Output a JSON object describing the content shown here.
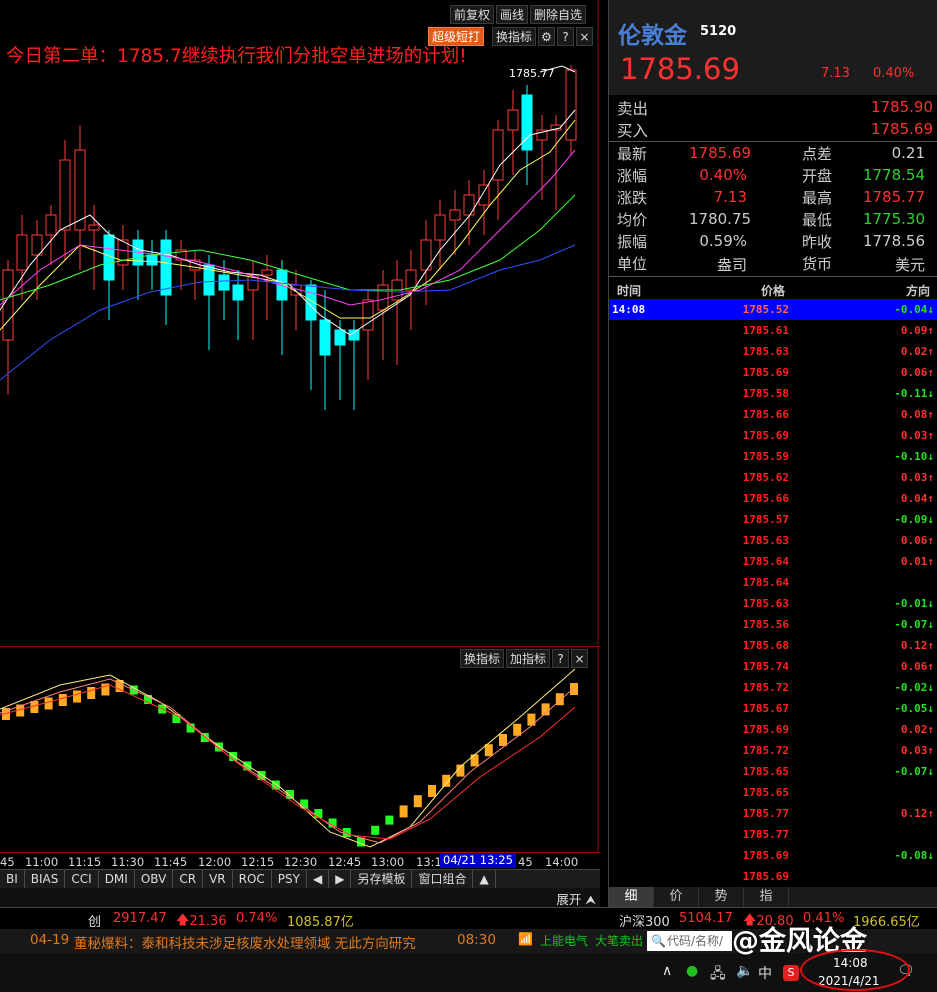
{
  "toolbar": {
    "adjust": "前复权",
    "draw": "画线",
    "delete_self_select": "删除自选",
    "super_short": "超级短打",
    "change_indicator": "换指标",
    "settings_icon": "gear-icon",
    "help": "?",
    "close": "×"
  },
  "chart": {
    "title": "今日第二单：1785.7继续执行我们分批空单进场的计划!",
    "high_tag": "1785.77"
  },
  "indicator_panel": {
    "change_indicator": "换指标",
    "add_indicator": "加指标",
    "help": "?",
    "close": "×"
  },
  "time_axis": {
    "labels": [
      "45",
      "11:00",
      "11:15",
      "11:30",
      "11:45",
      "12:00",
      "12:15",
      "12:30",
      "12:45",
      "13:00",
      "13:1",
      "45",
      "14:00"
    ],
    "cursor": "04/21 13:25"
  },
  "indicator_tabs": [
    "BI",
    "BIAS",
    "CCI",
    "DMI",
    "OBV",
    "CR",
    "VR",
    "ROC",
    "PSY",
    "◀",
    "▶",
    "另存模板",
    "窗口组合",
    "▲"
  ],
  "expand_label": "展开",
  "quote": {
    "name": "伦敦金",
    "code": "5120",
    "price": "1785.69",
    "change": "7.13",
    "pct": "0.40%",
    "sell_label": "卖出",
    "sell": "1785.90",
    "buy_label": "买入",
    "buy": "1785.69",
    "stats": [
      {
        "l1": "最新",
        "v1": "1785.69",
        "c1": "#ff3030",
        "l2": "点差",
        "v2": "0.21",
        "c2": "#cccccc"
      },
      {
        "l1": "涨幅",
        "v1": "0.40%",
        "c1": "#ff3030",
        "l2": "开盘",
        "v2": "1778.54",
        "c2": "#30d030"
      },
      {
        "l1": "涨跌",
        "v1": "7.13",
        "c1": "#ff3030",
        "l2": "最高",
        "v2": "1785.77",
        "c2": "#ff3030"
      },
      {
        "l1": "均价",
        "v1": "1780.75",
        "c1": "#cccccc",
        "l2": "最低",
        "v2": "1775.30",
        "c2": "#30d030"
      },
      {
        "l1": "振幅",
        "v1": "0.59%",
        "c1": "#cccccc",
        "l2": "昨收",
        "v2": "1778.56",
        "c2": "#cccccc"
      },
      {
        "l1": "单位",
        "v1": "盎司",
        "c1": "#cccccc",
        "l2": "货币",
        "v2": "美元",
        "c2": "#cccccc"
      }
    ],
    "tick_header": {
      "time": "时间",
      "price": "价格",
      "dir": "方向"
    },
    "ticks": [
      {
        "time": "14:08",
        "price": "1785.52",
        "dir": "-0.04↓",
        "up": false
      },
      {
        "time": "",
        "price": "1785.61",
        "dir": "0.09↑",
        "up": true
      },
      {
        "time": "",
        "price": "1785.63",
        "dir": "0.02↑",
        "up": true
      },
      {
        "time": "",
        "price": "1785.69",
        "dir": "0.06↑",
        "up": true
      },
      {
        "time": "",
        "price": "1785.58",
        "dir": "-0.11↓",
        "up": false
      },
      {
        "time": "",
        "price": "1785.66",
        "dir": "0.08↑",
        "up": true
      },
      {
        "time": "",
        "price": "1785.69",
        "dir": "0.03↑",
        "up": true
      },
      {
        "time": "",
        "price": "1785.59",
        "dir": "-0.10↓",
        "up": false
      },
      {
        "time": "",
        "price": "1785.62",
        "dir": "0.03↑",
        "up": true
      },
      {
        "time": "",
        "price": "1785.66",
        "dir": "0.04↑",
        "up": true
      },
      {
        "time": "",
        "price": "1785.57",
        "dir": "-0.09↓",
        "up": false
      },
      {
        "time": "",
        "price": "1785.63",
        "dir": "0.06↑",
        "up": true
      },
      {
        "time": "",
        "price": "1785.64",
        "dir": "0.01↑",
        "up": true
      },
      {
        "time": "",
        "price": "1785.64",
        "dir": "",
        "up": true
      },
      {
        "time": "",
        "price": "1785.63",
        "dir": "-0.01↓",
        "up": false
      },
      {
        "time": "",
        "price": "1785.56",
        "dir": "-0.07↓",
        "up": false
      },
      {
        "time": "",
        "price": "1785.68",
        "dir": "0.12↑",
        "up": true
      },
      {
        "time": "",
        "price": "1785.74",
        "dir": "0.06↑",
        "up": true
      },
      {
        "time": "",
        "price": "1785.72",
        "dir": "-0.02↓",
        "up": false
      },
      {
        "time": "",
        "price": "1785.67",
        "dir": "-0.05↓",
        "up": false
      },
      {
        "time": "",
        "price": "1785.69",
        "dir": "0.02↑",
        "up": true
      },
      {
        "time": "",
        "price": "1785.72",
        "dir": "0.03↑",
        "up": true
      },
      {
        "time": "",
        "price": "1785.65",
        "dir": "-0.07↓",
        "up": false
      },
      {
        "time": "",
        "price": "1785.65",
        "dir": "",
        "up": true
      },
      {
        "time": "",
        "price": "1785.77",
        "dir": "0.12↑",
        "up": true
      },
      {
        "time": "",
        "price": "1785.77",
        "dir": "",
        "up": true
      },
      {
        "time": "",
        "price": "1785.69",
        "dir": "-0.08↓",
        "up": false
      },
      {
        "time": "",
        "price": "1785.69",
        "dir": "",
        "up": true
      }
    ],
    "tabs": [
      "细",
      "价",
      "势",
      "指"
    ]
  },
  "ticker": {
    "chuang_label": "创",
    "chuang_val": "2917.47",
    "chuang_chg": "21.36",
    "chuang_pct": "0.74%",
    "chuang_amt": "1085.87亿",
    "hs_label": "沪深300",
    "hs_val": "5104.17",
    "hs_chg": "20.80",
    "hs_pct": "0.41%",
    "hs_amt": "1966.65亿"
  },
  "news": {
    "date": "04-19",
    "text": "董秘爆料：泰和科技未涉足核废水处理领域 无此方向研究",
    "time": "08:30",
    "stock": "上能电气",
    "action": "大笔卖出"
  },
  "taskbar": {
    "search_placeholder": "代码/名称/",
    "watermark": "@金风论金",
    "ime": "中",
    "time": "14:08",
    "date": "2021/4/21"
  },
  "colors": {
    "up": "#ff2020",
    "down": "#00ffff",
    "green": "#20d020",
    "accent": "#4a7fd8"
  }
}
